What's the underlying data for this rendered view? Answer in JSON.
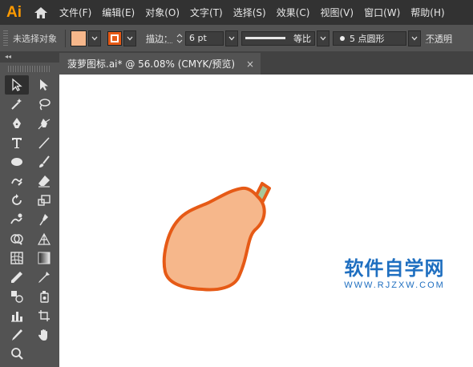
{
  "app": {
    "logo_text": "Ai"
  },
  "menu": [
    "文件(F)",
    "编辑(E)",
    "对象(O)",
    "文字(T)",
    "选择(S)",
    "效果(C)",
    "视图(V)",
    "窗口(W)",
    "帮助(H)"
  ],
  "control_bar": {
    "selection_label": "未选择对象",
    "fill_color": "#f6b78b",
    "stroke_color": "#e65a16",
    "stroke_label": "描边：",
    "stroke_weight": "6 pt",
    "profile_label": "等比",
    "brush_label": "5 点圆形",
    "opacity_label": "不透明"
  },
  "document_tab": {
    "title": "菠萝图标.ai* @ 56.08% (CMYK/预览)",
    "close": "×"
  },
  "toolbar": {
    "collapse_label": "◂◂"
  },
  "artwork": {
    "fill": "#f6b78b",
    "stroke": "#e65a16",
    "stem_fill": "#a8c79a"
  },
  "watermark": {
    "main": "软件自学网",
    "sub": "WWW.RJZXW.COM",
    "color": "#1f6fc0"
  }
}
